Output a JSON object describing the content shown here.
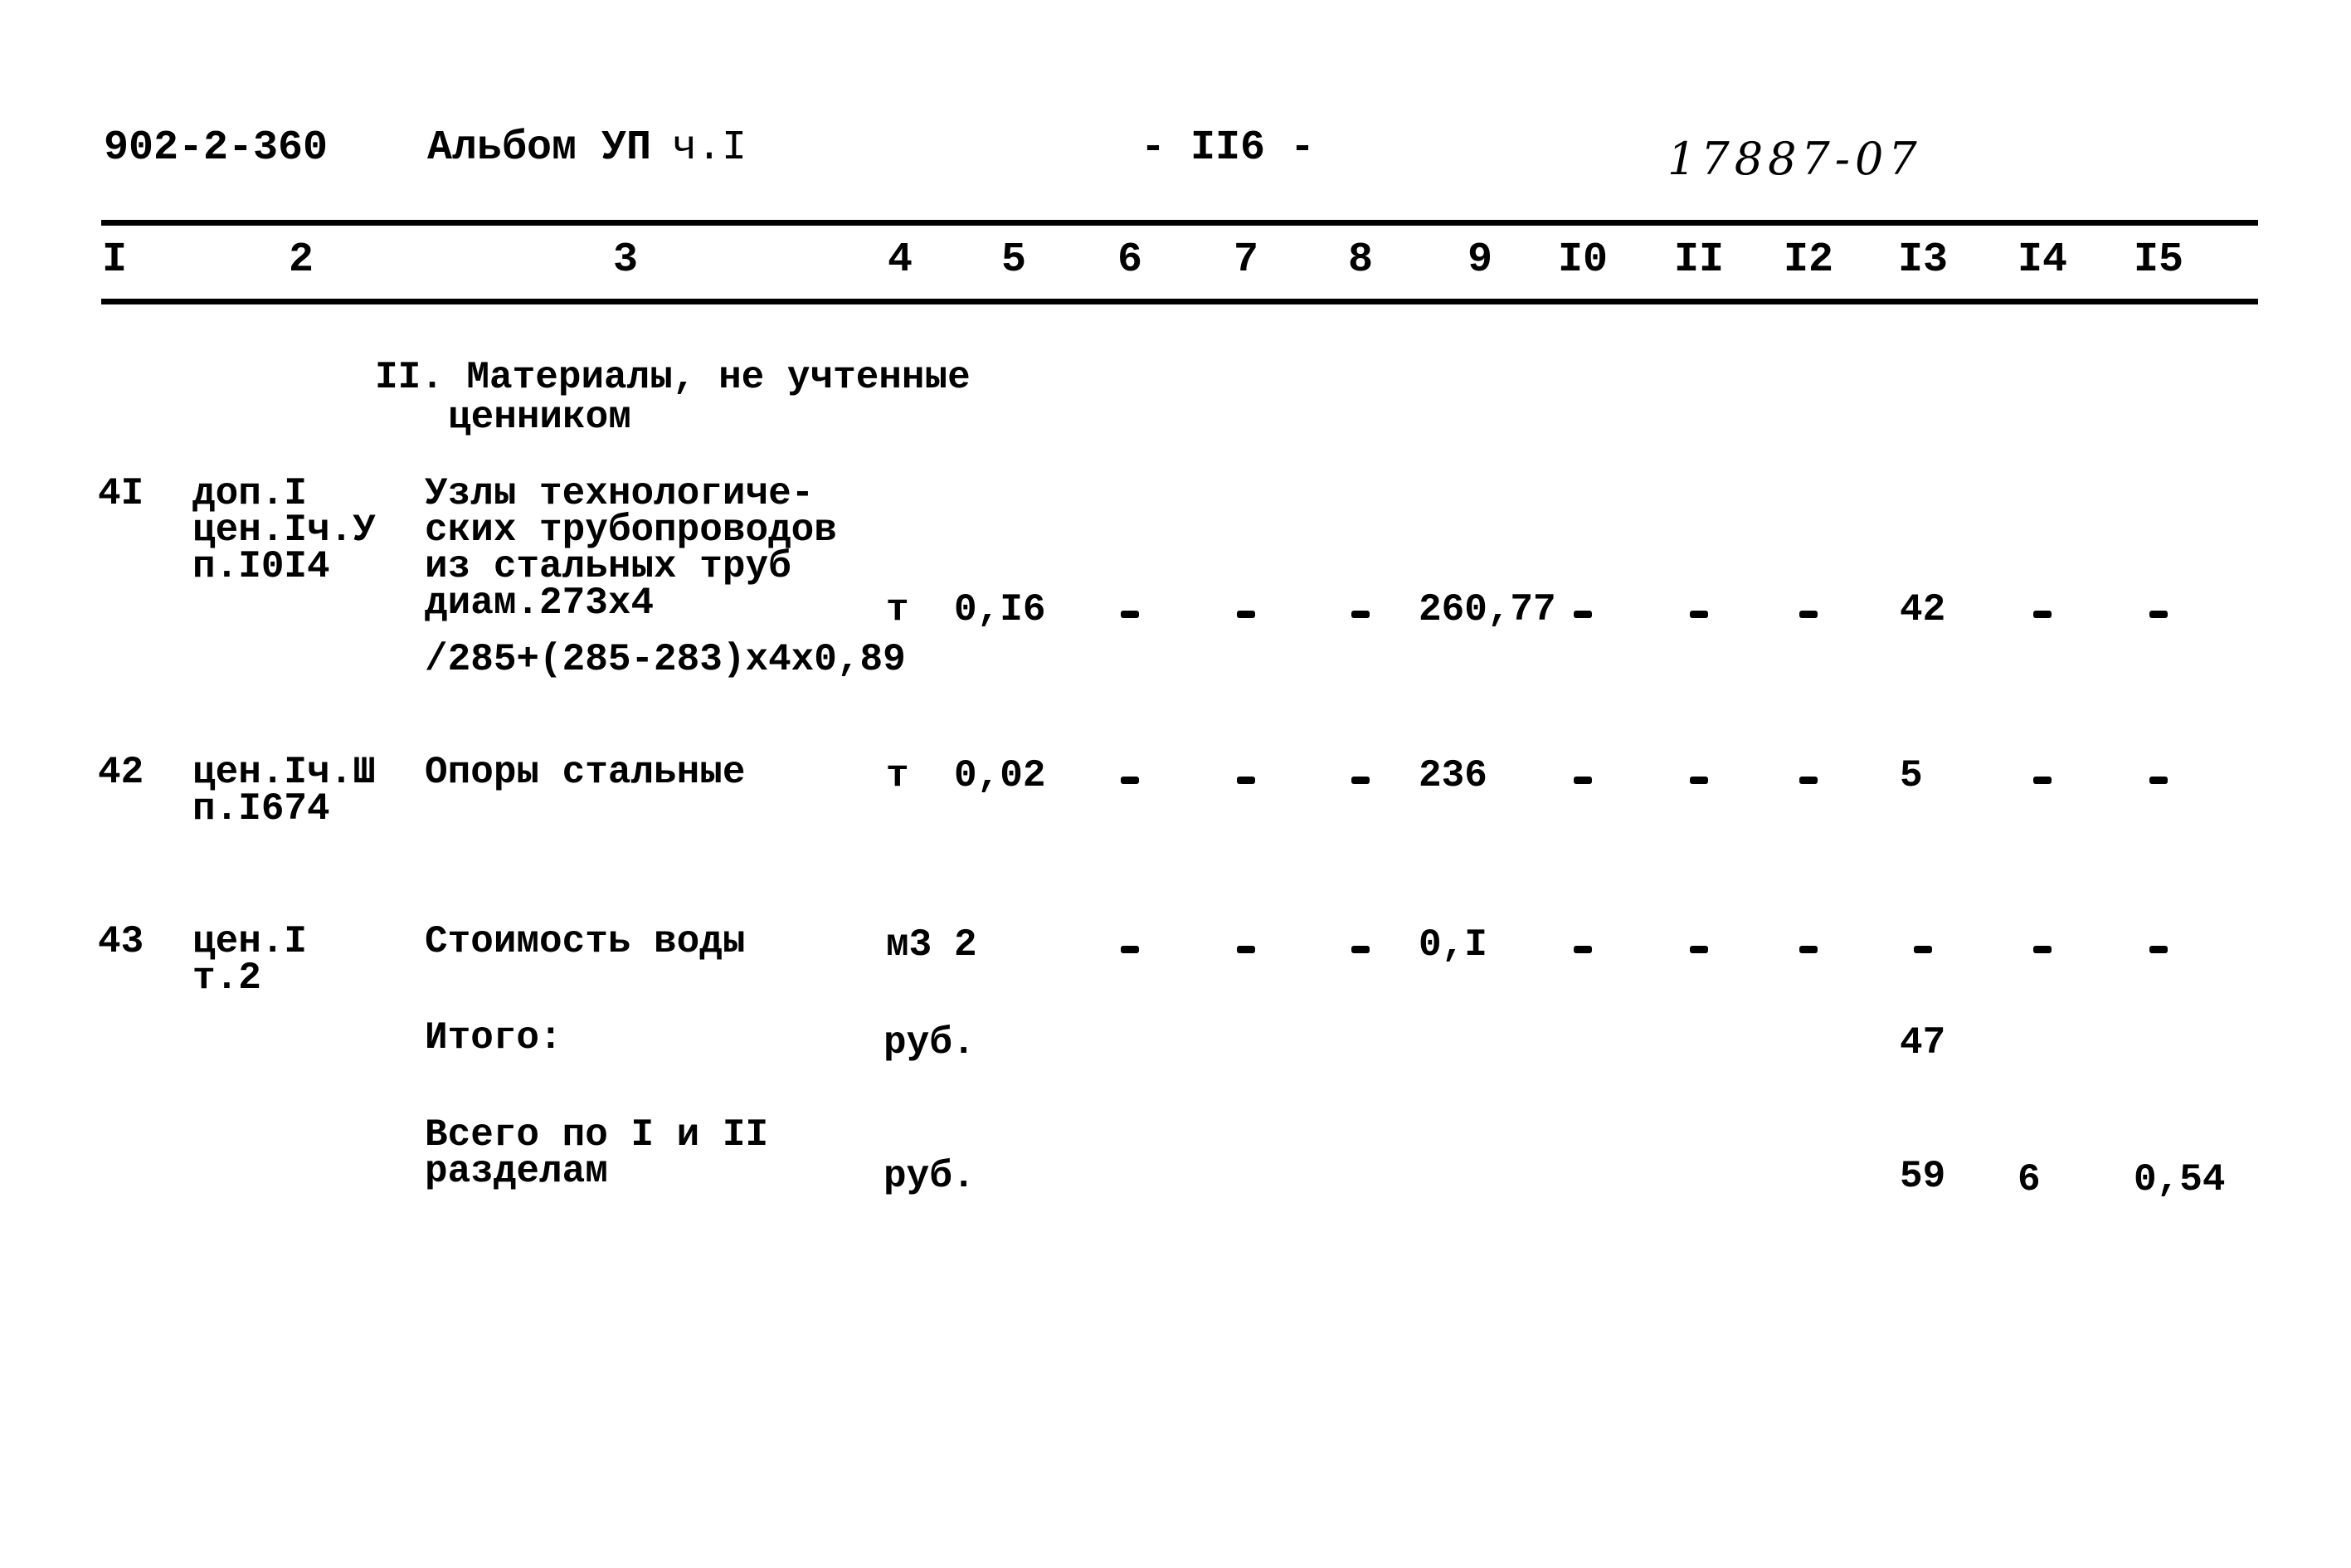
{
  "header": {
    "doc_code": "902-2-360",
    "album": "Альбом УП",
    "part": "ч.I",
    "page": "- II6 -",
    "handwritten_number": "17887-07"
  },
  "columns": [
    "I",
    "2",
    "3",
    "4",
    "5",
    "6",
    "7",
    "8",
    "9",
    "I0",
    "II",
    "I2",
    "I3",
    "I4",
    "I5"
  ],
  "section_title": [
    "II. Материалы, не учтенные",
    "ценником"
  ],
  "rows": [
    {
      "num": "4I",
      "ref": [
        "доп.I",
        "цен.Iч.У",
        "п.I0I4"
      ],
      "name": [
        "Узлы технологиче-",
        "ских трубопроводов",
        "из стальных труб",
        "диам.273х4"
      ],
      "note": "/285+(285-283)х4х0,89",
      "unit": "т",
      "qty": "0,I6",
      "c6": "-",
      "c7": "-",
      "c8": "-",
      "c9": "260,77",
      "c10": "-",
      "c11": "-",
      "c12": "-",
      "c13": "42",
      "c14": "-",
      "c15": "-"
    },
    {
      "num": "42",
      "ref": [
        "цен.Iч.Ш",
        "п.I674"
      ],
      "name": [
        "Опоры стальные"
      ],
      "unit": "т",
      "qty": "0,02",
      "c6": "-",
      "c7": "-",
      "c8": "-",
      "c9": "236",
      "c10": "-",
      "c11": "-",
      "c12": "-",
      "c13": "5",
      "c14": "-",
      "c15": "-"
    },
    {
      "num": "43",
      "ref": [
        "цен.I",
        "т.2"
      ],
      "name": [
        "Стоимость воды"
      ],
      "unit": "м3",
      "qty": "2",
      "c6": "-",
      "c7": "-",
      "c8": "-",
      "c9": "0,I",
      "c10": "-",
      "c11": "-",
      "c12": "-",
      "c13": "-",
      "c14": "-",
      "c15": "-"
    }
  ],
  "totals": [
    {
      "label": [
        "Итого:"
      ],
      "unit": "руб.",
      "c13": "47"
    },
    {
      "label": [
        "Всего по I и II",
        "разделам"
      ],
      "unit": "руб.",
      "c13": "59",
      "c14": "6",
      "c15": "0,54"
    }
  ]
}
